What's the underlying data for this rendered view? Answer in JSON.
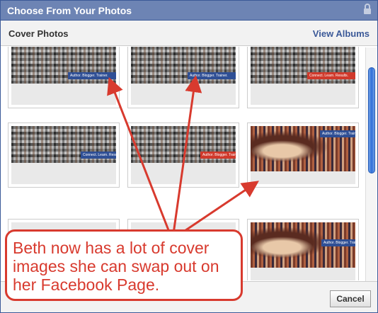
{
  "dialog": {
    "title": "Choose From Your Photos",
    "lock_icon": "lock-icon"
  },
  "subheader": {
    "album_label": "Cover Photos",
    "view_albums_link": "View Albums"
  },
  "tiles": [
    {
      "band_text": "Author. Blogger. Trainer."
    },
    {
      "band_text": "Author. Blogger. Trainer."
    },
    {
      "band_text": "Connect. Learn. Results."
    },
    {
      "band_text": "Connect. Learn. Results."
    },
    {
      "band_text": "Author. Blogger. Trainer."
    },
    {
      "band_text": "Author. Blogger. Trainer."
    },
    {
      "band_text": ""
    },
    {
      "band_text": ""
    },
    {
      "band_text": "Author. Blogger. Trainer."
    }
  ],
  "callout": {
    "text": "Beth now has a lot of cover images she can swap out on her Facebook Page."
  },
  "footer": {
    "cancel_label": "Cancel"
  },
  "colors": {
    "header_blue": "#6d84b4",
    "link_blue": "#3b5998",
    "annotation_red": "#d83a2e"
  }
}
